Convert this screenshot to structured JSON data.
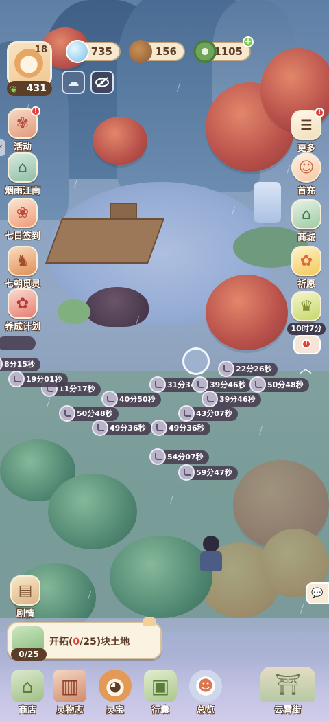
{
  "player": {
    "level": "18",
    "energy": "431"
  },
  "currencies": [
    {
      "name": "water-drop",
      "value": "735"
    },
    {
      "name": "acorn",
      "value": "156"
    },
    {
      "name": "jade-coin",
      "value": "1105"
    }
  ],
  "left_menu": [
    {
      "label": "活动",
      "icon": "fan-icon",
      "badge": true
    },
    {
      "label": "烟雨江南",
      "icon": "pavilion-icon",
      "badge": false
    },
    {
      "label": "七日签到",
      "icon": "folding-fan-icon",
      "badge": false
    },
    {
      "label": "七朝觅灵",
      "icon": "fox-icon",
      "badge": false
    },
    {
      "label": "养成计划",
      "icon": "flower-icon",
      "badge": false
    }
  ],
  "right_menu": [
    {
      "label": "更多",
      "icon": "menu-icon",
      "badge": true
    },
    {
      "label": "首充",
      "icon": "girl-icon",
      "badge": false
    },
    {
      "label": "商城",
      "icon": "shop-icon",
      "badge": false
    },
    {
      "label": "祈愿",
      "icon": "flower-icon",
      "badge": false
    },
    {
      "label": "10时7分",
      "icon": "lucky-bag-icon",
      "badge": false
    }
  ],
  "story_button": {
    "label": "剧情"
  },
  "task": {
    "text_prefix": "开拓(",
    "current": "0",
    "text_sep": "/",
    "total": "25",
    "text_suffix": ")块土地",
    "progress": "0/25"
  },
  "timers": [
    "22分26秒",
    "31分34秒",
    "39分46秒",
    "50分48秒",
    "11分17秒",
    "40分50秒",
    "39分46秒",
    "19分01秒",
    "50分48秒",
    "43分07秒",
    "49分36秒",
    "49分36秒",
    "54分07秒",
    "59分47秒",
    "8分15秒"
  ],
  "bottom_nav": [
    {
      "label": "商店",
      "icon": "shop-stall-icon"
    },
    {
      "label": "灵物志",
      "icon": "book-icon"
    },
    {
      "label": "灵宝",
      "icon": "corgi-icon"
    },
    {
      "label": "行囊",
      "icon": "bag-icon"
    },
    {
      "label": "总览",
      "icon": "astronaut-icon"
    },
    {
      "label": "云霄街",
      "icon": "gate-icon"
    }
  ]
}
